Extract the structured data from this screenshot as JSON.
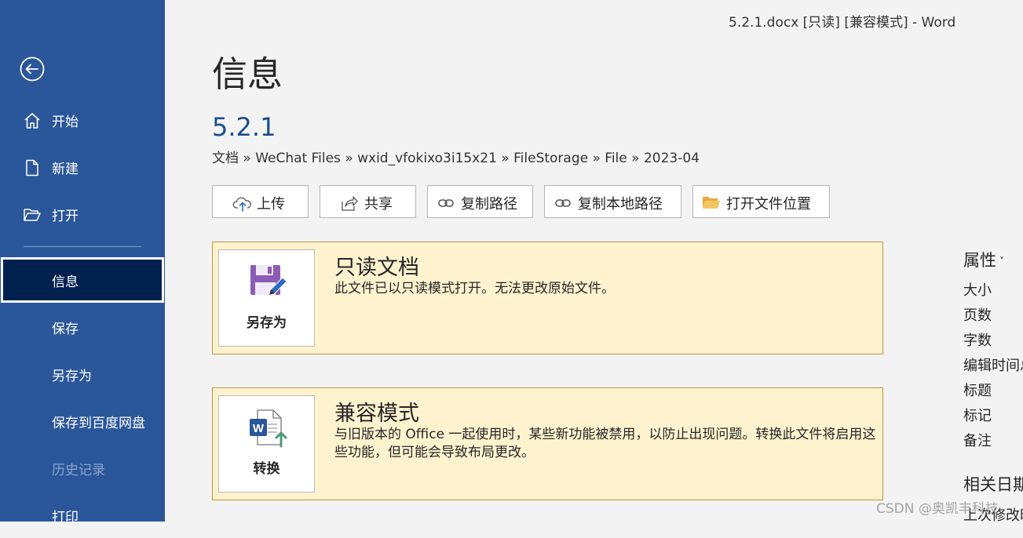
{
  "window": {
    "title": "5.2.1.docx [只读] [兼容模式]  -  Word"
  },
  "sidebar": {
    "back_icon": "back-arrow-icon",
    "items": [
      {
        "label": "开始",
        "icon": "home-icon"
      },
      {
        "label": "新建",
        "icon": "new-document-icon"
      },
      {
        "label": "打开",
        "icon": "open-folder-icon"
      },
      {
        "label": "信息",
        "active": true
      },
      {
        "label": "保存"
      },
      {
        "label": "另存为"
      },
      {
        "label": "保存到百度网盘"
      },
      {
        "label": "历史记录",
        "disabled": true
      },
      {
        "label": "打印"
      }
    ],
    "colors": {
      "background": "#2b579a",
      "active": "#00204e"
    }
  },
  "main": {
    "heading": "信息",
    "document_name": "5.2.1",
    "breadcrumb": "文档 » WeChat Files » wxid_vfokixo3i15x21 » FileStorage » File » 2023-04",
    "toolbar": [
      {
        "label": "上传",
        "icon": "cloud-upload-icon"
      },
      {
        "label": "共享",
        "icon": "share-icon"
      },
      {
        "label": "复制路径",
        "icon": "link-icon"
      },
      {
        "label": "复制本地路径",
        "icon": "link-icon"
      },
      {
        "label": "打开文件位置",
        "icon": "folder-icon"
      }
    ],
    "read_only_panel": {
      "card_label": "另存为",
      "title": "只读文档",
      "description": "此文件已以只读模式打开。无法更改原始文件。"
    },
    "compat_panel": {
      "card_label": "转换",
      "title": "兼容模式",
      "description": "与旧版本的 Office 一起使用时，某些新功能被禁用，以防止出现问题。转换此文件将启用这些功能，但可能会导致布局更改。"
    },
    "colors": {
      "panel_bg": "#fff3cf",
      "panel_border": "#c2943d",
      "doc_name": "#1e4e8c"
    }
  },
  "properties": {
    "heading": "属性",
    "items": [
      "大小",
      "页数",
      "字数",
      "编辑时间总计",
      "标题",
      "标记",
      "备注"
    ],
    "related_dates_heading": "相关日期",
    "last_modified_label": "上次修改时间"
  },
  "watermark": "CSDN @奥凯丰科技"
}
